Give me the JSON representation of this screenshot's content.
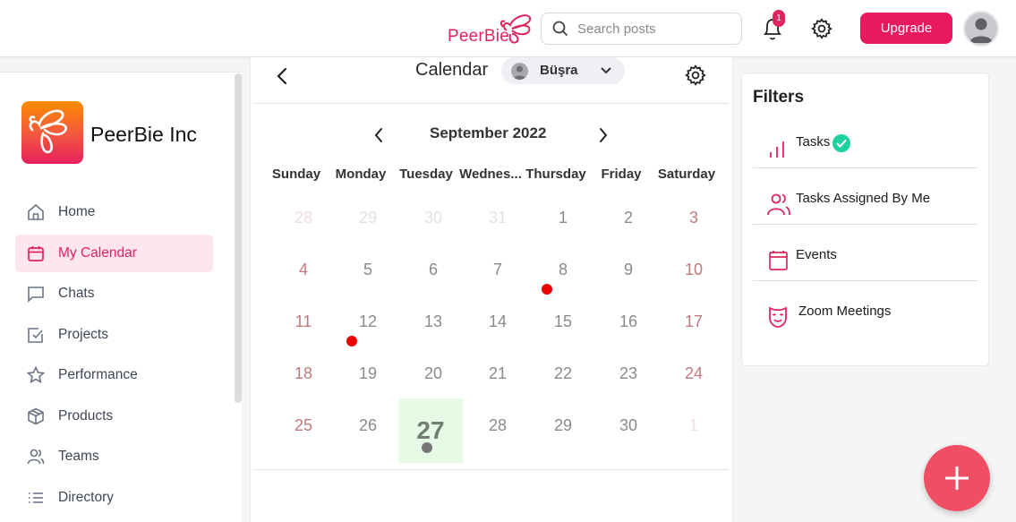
{
  "header": {
    "brand": "PeerBie",
    "search_placeholder": "Search posts",
    "notification_count": "1",
    "upgrade_label": "Upgrade"
  },
  "sidebar": {
    "org_name": "PeerBie Inc",
    "items": [
      {
        "label": "Home",
        "icon": "home-icon",
        "active": false
      },
      {
        "label": "My Calendar",
        "icon": "calendar-icon",
        "active": true
      },
      {
        "label": "Chats",
        "icon": "chat-icon",
        "active": false
      },
      {
        "label": "Projects",
        "icon": "checkbox-icon",
        "active": false
      },
      {
        "label": "Performance",
        "icon": "star-icon",
        "active": false
      },
      {
        "label": "Products",
        "icon": "box-icon",
        "active": false
      },
      {
        "label": "Teams",
        "icon": "users-icon",
        "active": false
      },
      {
        "label": "Directory",
        "icon": "list-icon",
        "active": false
      }
    ]
  },
  "calendar": {
    "title": "Calendar",
    "user": "Büşra",
    "month_label": "September 2022",
    "weekdays": [
      "Sunday",
      "Monday",
      "Tuesday",
      "Wednes...",
      "Thursday",
      "Friday",
      "Saturday"
    ],
    "weeks": [
      [
        "28",
        "29",
        "30",
        "31",
        "1",
        "2",
        "3"
      ],
      [
        "4",
        "5",
        "6",
        "7",
        "8",
        "9",
        "10"
      ],
      [
        "11",
        "12",
        "13",
        "14",
        "15",
        "16",
        "17"
      ],
      [
        "18",
        "19",
        "20",
        "21",
        "22",
        "23",
        "24"
      ],
      [
        "25",
        "26",
        "27",
        "28",
        "29",
        "30",
        "1"
      ]
    ],
    "today": "27",
    "event_days": [
      "8",
      "12",
      "27"
    ],
    "colors": {
      "event_dot": "#ee0000",
      "today_bg": "#e6fbe6",
      "weekend": "#c07a7d"
    }
  },
  "filters": {
    "title": "Filters",
    "items": [
      {
        "label": "Tasks",
        "icon": "bar-chart-icon",
        "checked": true
      },
      {
        "label": "Tasks Assigned By Me",
        "icon": "users-icon",
        "checked": false
      },
      {
        "label": "Events",
        "icon": "calendar-icon",
        "checked": false
      },
      {
        "label": "Zoom Meetings",
        "icon": "mask-icon",
        "checked": false
      }
    ]
  },
  "colors": {
    "accent": "#e8195f",
    "fab": "#f04e64",
    "check": "#1dd1a1"
  }
}
